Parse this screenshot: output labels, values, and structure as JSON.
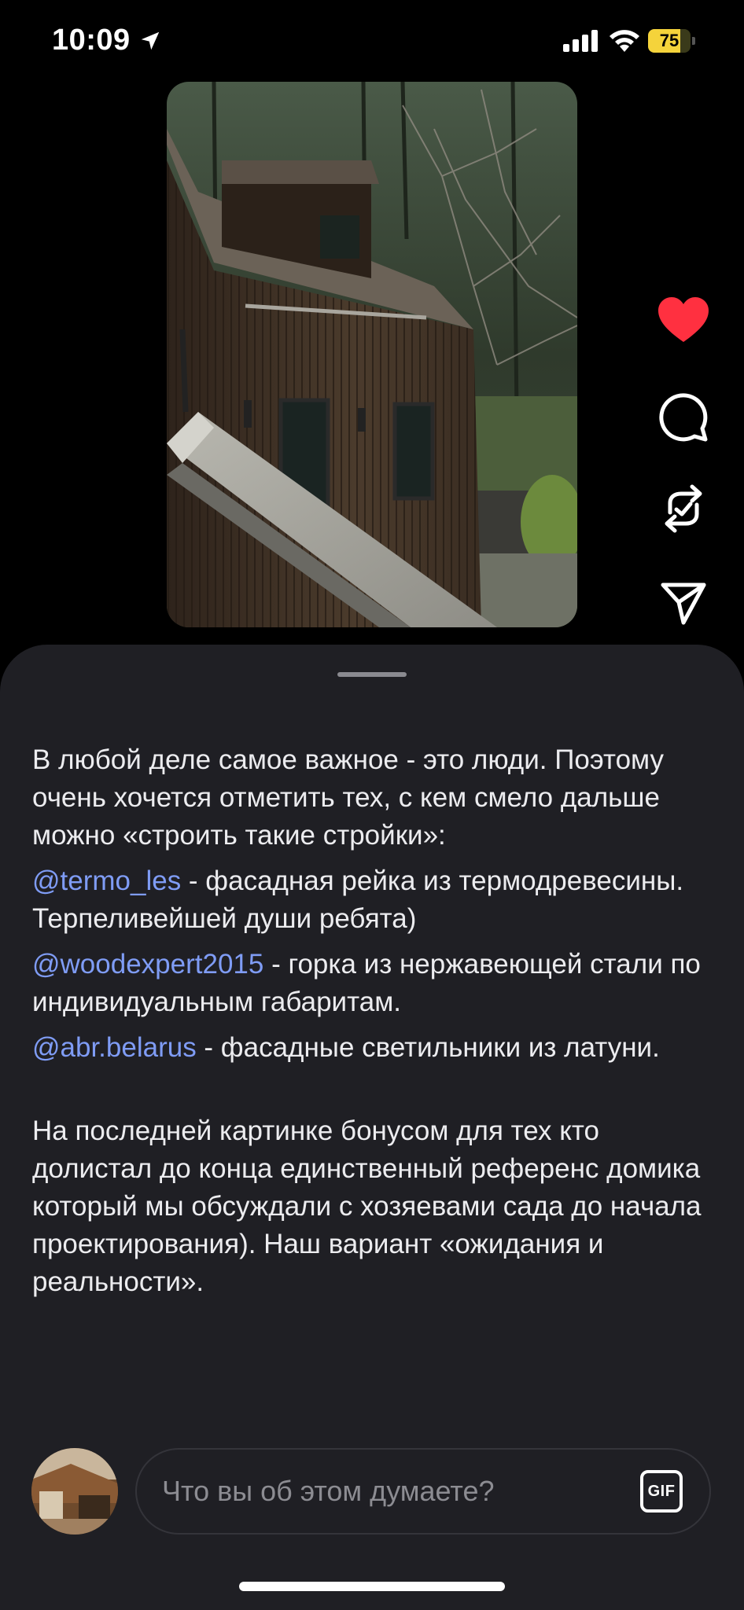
{
  "status_bar": {
    "time": "10:09",
    "battery_level": 75,
    "battery_label": "75"
  },
  "post": {
    "media_icon": "photo",
    "liked": true,
    "colors": {
      "like": "#ff3040",
      "mention": "#7f9cf5",
      "sheet": "#1f1f24"
    }
  },
  "caption": {
    "intro": "В любой деле самое важное - это люди. Поэтому очень хочется отметить тех, с кем смело дальше можно «строить такие стройки»:",
    "credits": [
      {
        "handle": "@termo_les",
        "text": " - фасадная рейка из термодревесины. Терпеливейшей души ребята)"
      },
      {
        "handle": "@woodexpert2015",
        "text": " - горка из нержавеющей стали по индивидуальным габаритам."
      },
      {
        "handle": "@abr.belarus",
        "text": " -  фасадные светильники из латуни."
      }
    ],
    "outro": "На последней картинке бонусом для тех кто долистал до конца единственный референс домика который мы обсуждали с хозяевами сада до начала проектирования). Наш вариант «ожидания и реальности»."
  },
  "comment_bar": {
    "placeholder": "Что вы об этом думаете?",
    "gif_label": "GIF"
  }
}
